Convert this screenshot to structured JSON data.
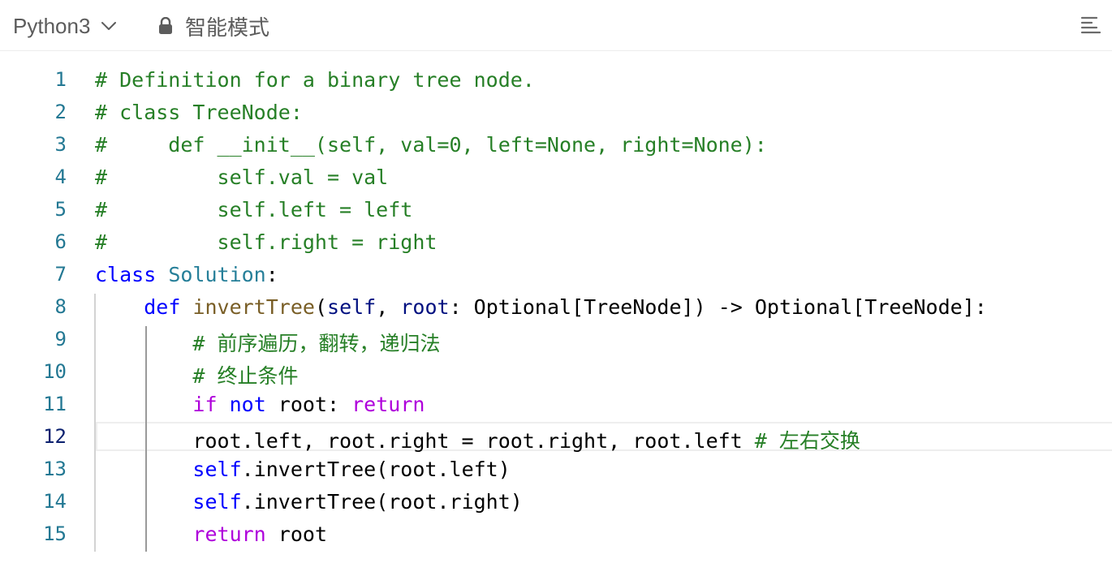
{
  "toolbar": {
    "language": "Python3",
    "mode_label": "智能模式"
  },
  "editor": {
    "current_line": 12,
    "lines": [
      {
        "n": "1",
        "tokens": [
          {
            "t": "# Definition for a binary tree node.",
            "c": "cm"
          }
        ]
      },
      {
        "n": "2",
        "tokens": [
          {
            "t": "# class TreeNode:",
            "c": "cm"
          }
        ]
      },
      {
        "n": "3",
        "tokens": [
          {
            "t": "#     def __init__(self, val=0, left=None, right=None):",
            "c": "cm"
          }
        ]
      },
      {
        "n": "4",
        "tokens": [
          {
            "t": "#         self.val = val",
            "c": "cm"
          }
        ]
      },
      {
        "n": "5",
        "tokens": [
          {
            "t": "#         self.left = left",
            "c": "cm"
          }
        ]
      },
      {
        "n": "6",
        "tokens": [
          {
            "t": "#         self.right = right",
            "c": "cm"
          }
        ]
      },
      {
        "n": "7",
        "tokens": [
          {
            "t": "class",
            "c": "kw"
          },
          {
            "t": " "
          },
          {
            "t": "Solution",
            "c": "cls"
          },
          {
            "t": ":"
          }
        ]
      },
      {
        "n": "8",
        "tokens": [
          {
            "t": "    "
          },
          {
            "t": "def",
            "c": "kw"
          },
          {
            "t": " "
          },
          {
            "t": "invertTree",
            "c": "fn"
          },
          {
            "t": "("
          },
          {
            "t": "self",
            "c": "param"
          },
          {
            "t": ", "
          },
          {
            "t": "root",
            "c": "param"
          },
          {
            "t": ": Optional[TreeNode]) -> Optional[TreeNode]:"
          }
        ]
      },
      {
        "n": "9",
        "tokens": [
          {
            "t": "        "
          },
          {
            "t": "# 前序遍历，翻转，递归法",
            "c": "cm"
          }
        ]
      },
      {
        "n": "10",
        "tokens": [
          {
            "t": "        "
          },
          {
            "t": "# 终止条件",
            "c": "cm"
          }
        ]
      },
      {
        "n": "11",
        "tokens": [
          {
            "t": "        "
          },
          {
            "t": "if",
            "c": "ctl"
          },
          {
            "t": " "
          },
          {
            "t": "not",
            "c": "kw"
          },
          {
            "t": " root: "
          },
          {
            "t": "return",
            "c": "ctl"
          }
        ]
      },
      {
        "n": "12",
        "tokens": [
          {
            "t": "        root.left, root.right = root.right, root.left "
          },
          {
            "t": "# 左右交换",
            "c": "cm"
          }
        ]
      },
      {
        "n": "13",
        "tokens": [
          {
            "t": "        "
          },
          {
            "t": "self",
            "c": "kw"
          },
          {
            "t": ".invertTree(root.left)"
          }
        ]
      },
      {
        "n": "14",
        "tokens": [
          {
            "t": "        "
          },
          {
            "t": "self",
            "c": "kw"
          },
          {
            "t": ".invertTree(root.right)"
          }
        ]
      },
      {
        "n": "15",
        "tokens": [
          {
            "t": "        "
          },
          {
            "t": "return",
            "c": "ctl"
          },
          {
            "t": " root"
          }
        ]
      }
    ]
  }
}
